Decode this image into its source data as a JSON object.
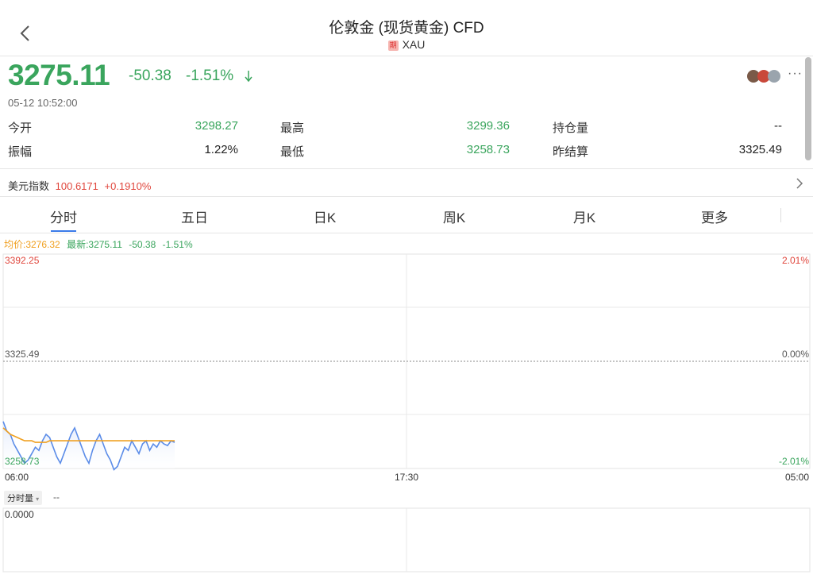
{
  "header": {
    "title": "伦敦金 (现货黄金) CFD",
    "badge": "期",
    "symbol": "XAU"
  },
  "quote": {
    "price": "3275.11",
    "change": "-50.38",
    "change_pct": "-1.51%",
    "time": "05-12 10:52:00"
  },
  "stats": [
    {
      "label": "今开",
      "value": "3298.27",
      "color": "green"
    },
    {
      "label": "振幅",
      "value": "1.22%",
      "color": "normal"
    },
    {
      "label": "最高",
      "value": "3299.36",
      "color": "green"
    },
    {
      "label": "最低",
      "value": "3258.73",
      "color": "green"
    },
    {
      "label": "持仓量",
      "value": "--",
      "color": "normal"
    },
    {
      "label": "昨结算",
      "value": "3325.49",
      "color": "normal"
    }
  ],
  "index": {
    "label": "美元指数",
    "value": "100.6171",
    "change": "+0.1910%"
  },
  "tabs": [
    "分时",
    "五日",
    "日K",
    "周K",
    "月K",
    "更多"
  ],
  "chart_stats": {
    "avg": "均价:3276.32",
    "latest": "最新:3275.11",
    "chg": "-50.38",
    "pct": "-1.51%"
  },
  "chart_data": {
    "type": "line",
    "y_top": "3392.25",
    "y_mid": "3325.49",
    "y_bottom": "3258.73",
    "pct_top": "2.01%",
    "pct_mid": "0.00%",
    "pct_bottom": "-2.01%",
    "x_labels": [
      "06:00",
      "17:30",
      "05:00"
    ],
    "ylim": [
      3258.73,
      3392.25
    ],
    "series": [
      {
        "values": [
          3288,
          3282,
          3280,
          3274,
          3270,
          3266,
          3262,
          3264,
          3268,
          3272,
          3270,
          3276,
          3280,
          3278,
          3272,
          3266,
          3262,
          3268,
          3274,
          3280,
          3284,
          3278,
          3272,
          3266,
          3262,
          3270,
          3276,
          3280,
          3274,
          3268,
          3264,
          3258,
          3260,
          3266,
          3272,
          3270,
          3276,
          3272,
          3268,
          3274,
          3276,
          3270,
          3274,
          3272,
          3276,
          3274,
          3273,
          3276,
          3275
        ]
      },
      {
        "values": [
          3284,
          3282,
          3280,
          3279,
          3278,
          3277,
          3276,
          3276,
          3276,
          3275,
          3275,
          3275,
          3275,
          3276,
          3276,
          3276,
          3276,
          3276,
          3276,
          3276,
          3276,
          3276,
          3276,
          3276,
          3276,
          3276,
          3276,
          3276,
          3276,
          3276,
          3276,
          3276,
          3276,
          3276,
          3276,
          3276,
          3276,
          3276,
          3276,
          3276,
          3276,
          3276,
          3276,
          3276,
          3276,
          3276,
          3276,
          3276,
          3276
        ]
      }
    ],
    "colors": {
      "price": "#5b8ce8",
      "avg": "#f0a020"
    }
  },
  "volume": {
    "selector": "分时量",
    "value": "--",
    "scale": "0.0000"
  }
}
